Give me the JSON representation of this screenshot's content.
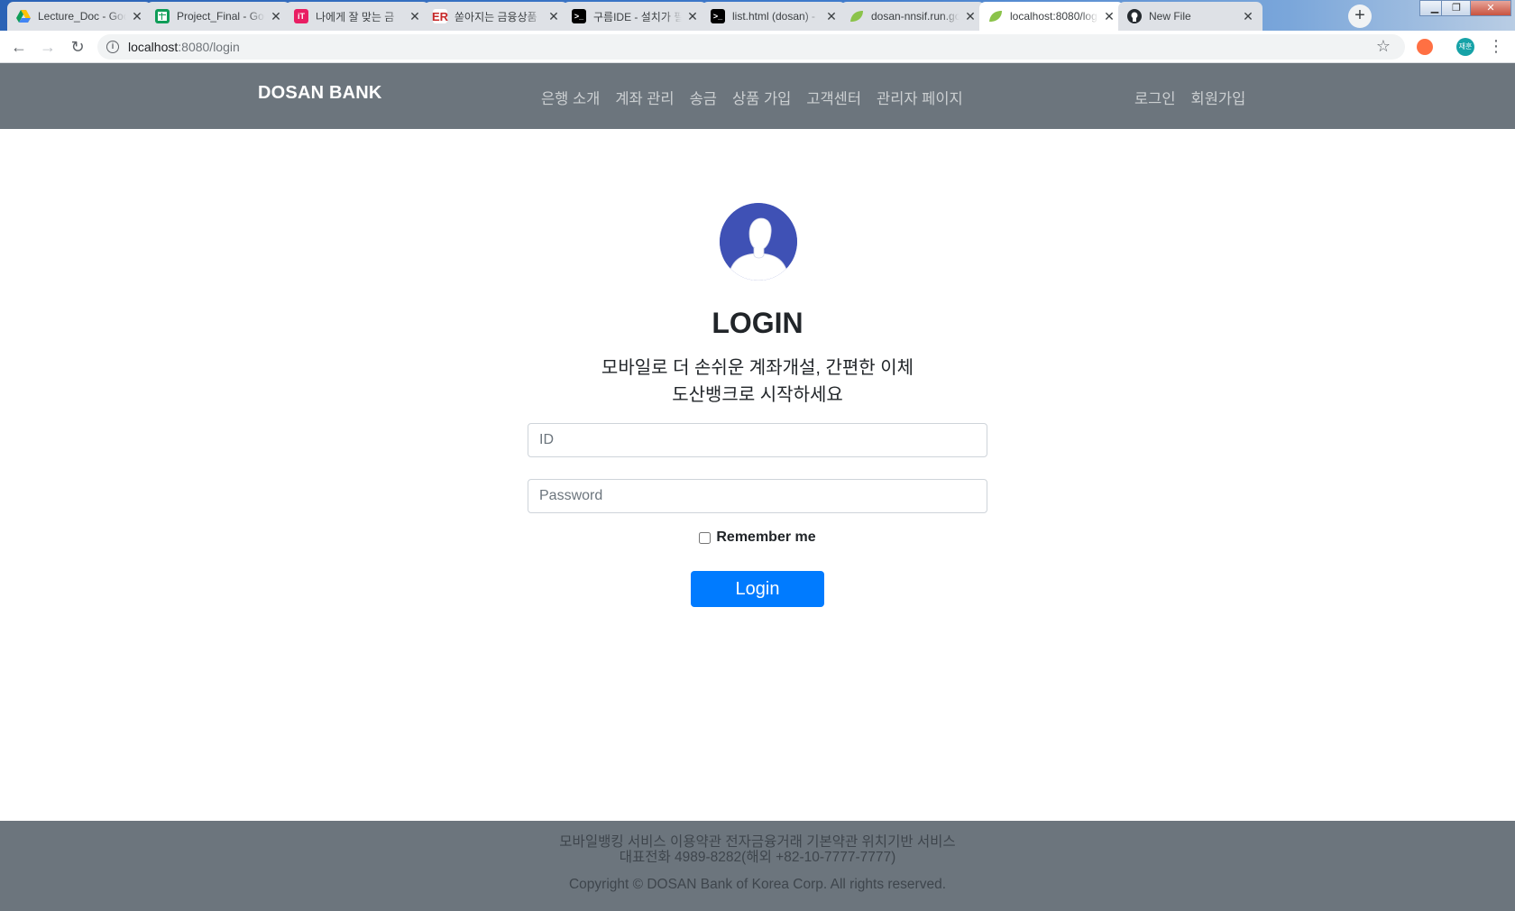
{
  "browser": {
    "tabs": [
      {
        "title": "Lecture_Doc - Goo",
        "favicon": "google-drive-icon",
        "active": false
      },
      {
        "title": "Project_Final - Goo",
        "favicon": "google-sheets-icon",
        "active": false
      },
      {
        "title": "나에게 잘 맞는 금",
        "favicon": "finance-app-icon",
        "active": false
      },
      {
        "title": "쏟아지는 금융상품",
        "favicon": "er-icon",
        "active": false
      },
      {
        "title": "구름IDE - 설치가 필",
        "favicon": "terminal-icon",
        "active": false
      },
      {
        "title": "list.html (dosan) -",
        "favicon": "terminal-icon",
        "active": false
      },
      {
        "title": "dosan-nnsif.run.go",
        "favicon": "spring-leaf-icon",
        "active": false
      },
      {
        "title": "localhost:8080/log",
        "favicon": "spring-leaf-icon",
        "active": true
      },
      {
        "title": "New File",
        "favicon": "github-icon",
        "active": false
      }
    ],
    "url_host": "localhost",
    "url_path": ":8080/login",
    "profile_initials": "재훈"
  },
  "nav": {
    "brand": "DOSAN BANK",
    "links": [
      "은행 소개",
      "계좌 관리",
      "송금",
      "상품 가입",
      "고객센터",
      "관리자 페이지"
    ],
    "right_links": [
      "로그인",
      "회원가입"
    ]
  },
  "login": {
    "title": "LOGIN",
    "subtitle_line1": "모바일로 더 손쉬운 계좌개설, 간편한 이체",
    "subtitle_line2": "도산뱅크로 시작하세요",
    "id_placeholder": "ID",
    "password_placeholder": "Password",
    "remember_label": "Remember me",
    "button_label": "Login"
  },
  "footer": {
    "links": "모바일뱅킹 서비스 이용약관 전자금융거래 기본약관 위치기반 서비스",
    "tel": "대표전화 4989-8282(해외 +82-10-7777-7777)",
    "copyright": "Copyright © DOSAN Bank of Korea Corp. All rights reserved."
  },
  "colors": {
    "navbar_bg": "#6c757d",
    "primary": "#007bff",
    "avatar_bg": "#3f51b5"
  }
}
